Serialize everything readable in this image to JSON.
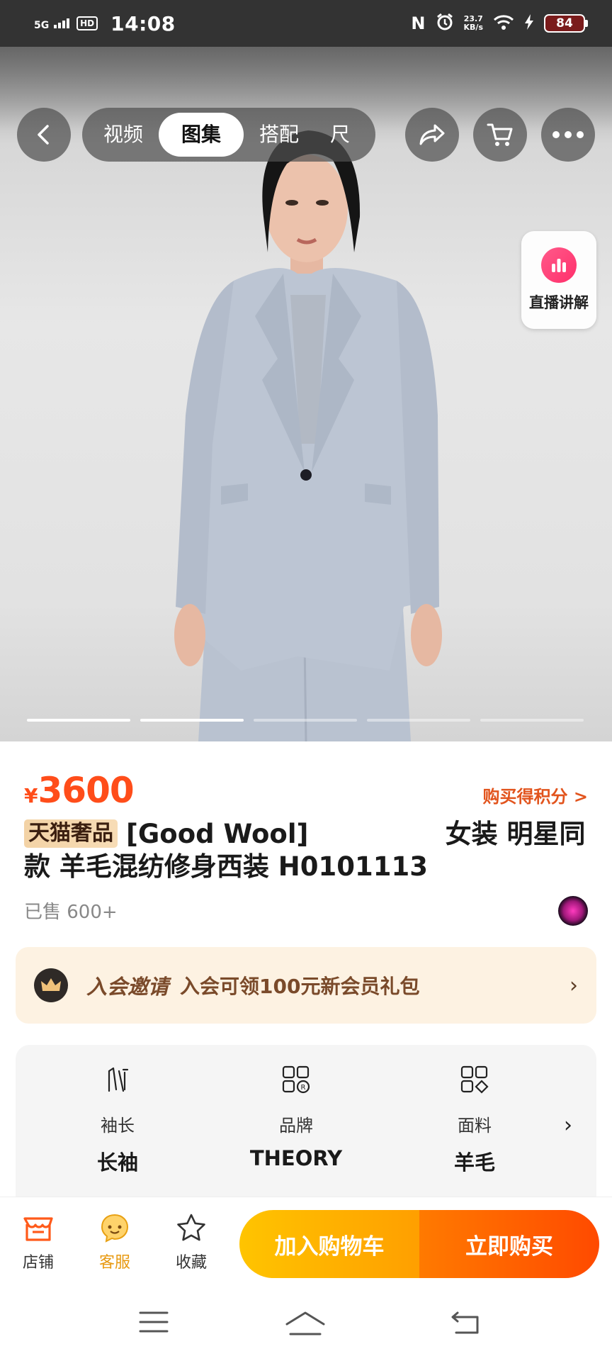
{
  "status_bar": {
    "network": "5G",
    "hd": "HD",
    "time": "14:08",
    "nfc": "N",
    "speed_value": "23.7",
    "speed_unit": "KB/s",
    "battery": "84"
  },
  "nav": {
    "tabs": [
      "视频",
      "图集",
      "搭配",
      "尺"
    ],
    "active_tab": "图集"
  },
  "live": {
    "label": "直播讲解"
  },
  "gallery": {
    "current_index": 2,
    "total": 5
  },
  "product": {
    "currency": "¥",
    "price": "3600",
    "points_label": "购买得积分 >",
    "badge": "天猫奢品",
    "title": "[Good Wool]               女装 明星同款 羊毛混纺修身西装 H0101113",
    "sold": "已售 600+"
  },
  "member": {
    "title": "入会邀请",
    "desc": "入会可领100元新会员礼包",
    "chevron": "›"
  },
  "attributes": [
    {
      "label": "袖长",
      "value": "长袖",
      "icon": "sleeve-icon"
    },
    {
      "label": "品牌",
      "value": "THEORY",
      "icon": "brand-icon"
    },
    {
      "label": "面料",
      "value": "羊毛",
      "icon": "fabric-icon"
    }
  ],
  "bottom": {
    "store": "店铺",
    "service": "客服",
    "favorite": "收藏",
    "add_cart": "加入购物车",
    "buy_now": "立即购买"
  },
  "colors": {
    "price": "#ff4d1a",
    "cart_button": "#ffb000",
    "buy_button": "#ff5a00",
    "member_bg": "#fdf2e2"
  }
}
